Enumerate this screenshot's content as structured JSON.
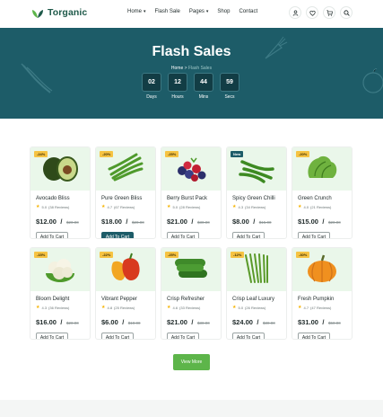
{
  "brand": {
    "name": "Torganic",
    "color": "#1f5a4a"
  },
  "nav": [
    {
      "label": "Home",
      "dropdown": true
    },
    {
      "label": "Flash Sale",
      "dropdown": false
    },
    {
      "label": "Pages",
      "dropdown": true
    },
    {
      "label": "Shop",
      "dropdown": false
    },
    {
      "label": "Contact",
      "dropdown": false
    }
  ],
  "header_icons": [
    "user-icon",
    "heart-icon",
    "cart-icon",
    "search-icon"
  ],
  "hero": {
    "title": "Flash Sales",
    "breadcrumb_home": "Home",
    "breadcrumb_sep": ">",
    "breadcrumb_current": "Flash Sales",
    "countdown": [
      {
        "value": "02",
        "label": "Days"
      },
      {
        "value": "12",
        "label": "Hours"
      },
      {
        "value": "44",
        "label": "Mins"
      },
      {
        "value": "59",
        "label": "Secs"
      }
    ]
  },
  "products": [
    {
      "name": "Avocado Bliss",
      "badge": "-24%",
      "rating": "5.0",
      "reviews": "(38 Reviews)",
      "price": "$12.00",
      "old": "$20.00",
      "button": "Add To Cart",
      "icon": "avocado-image"
    },
    {
      "name": "Pure Green Bliss",
      "badge": "-20%",
      "rating": "4.7",
      "reviews": "(67 Reviews)",
      "price": "$18.00",
      "old": "$20.00",
      "button": "Add To Cart",
      "icon": "green-beans-image",
      "active": true
    },
    {
      "name": "Berry Burst Pack",
      "badge": "-25%",
      "rating": "5.0",
      "reviews": "(28 Reviews)",
      "price": "$21.00",
      "old": "$30.00",
      "button": "Add To Cart",
      "icon": "berries-image"
    },
    {
      "name": "Spicy Green Chilli",
      "badge": "New",
      "rating": "4.3",
      "reviews": "(34 Reviews)",
      "price": "$8.00",
      "old": "$15.00",
      "button": "Add To Cart",
      "icon": "green-chilli-image"
    },
    {
      "name": "Green Crunch",
      "badge": "-20%",
      "rating": "4.0",
      "reviews": "(21 Reviews)",
      "price": "$15.00",
      "old": "$20.00",
      "button": "Add To Cart",
      "icon": "lettuce-image"
    },
    {
      "name": "Bloom Delight",
      "badge": "-15%",
      "rating": "4.3",
      "reviews": "(36 Reviews)",
      "price": "$16.00",
      "old": "$20.00",
      "button": "Add To Cart",
      "icon": "cauliflower-image"
    },
    {
      "name": "Vibrant Pepper",
      "badge": "-22%",
      "rating": "4.8",
      "reviews": "(25 Reviews)",
      "price": "$6.00",
      "old": "$10.00",
      "button": "Add To Cart",
      "icon": "bell-pepper-image"
    },
    {
      "name": "Crisp Refresher",
      "badge": "-25%",
      "rating": "4.6",
      "reviews": "(33 Reviews)",
      "price": "$21.00",
      "old": "$30.00",
      "button": "Add To Cart",
      "icon": "cucumber-image"
    },
    {
      "name": "Crisp Leaf Luxury",
      "badge": "-12%",
      "rating": "5.0",
      "reviews": "(26 Reviews)",
      "price": "$24.00",
      "old": "$30.00",
      "button": "Add To Cart",
      "icon": "long-beans-image"
    },
    {
      "name": "Fresh Pumpkin",
      "badge": "-30%",
      "rating": "4.7",
      "reviews": "(47 Reviews)",
      "price": "$31.00",
      "old": "$50.00",
      "button": "Add To Cart",
      "icon": "pumpkin-image"
    }
  ],
  "view_more": "View More",
  "colors": {
    "accent": "#1d5c68",
    "green_button": "#5db54a",
    "badge": "#f6c343",
    "card_bg": "#eaf7ea"
  }
}
